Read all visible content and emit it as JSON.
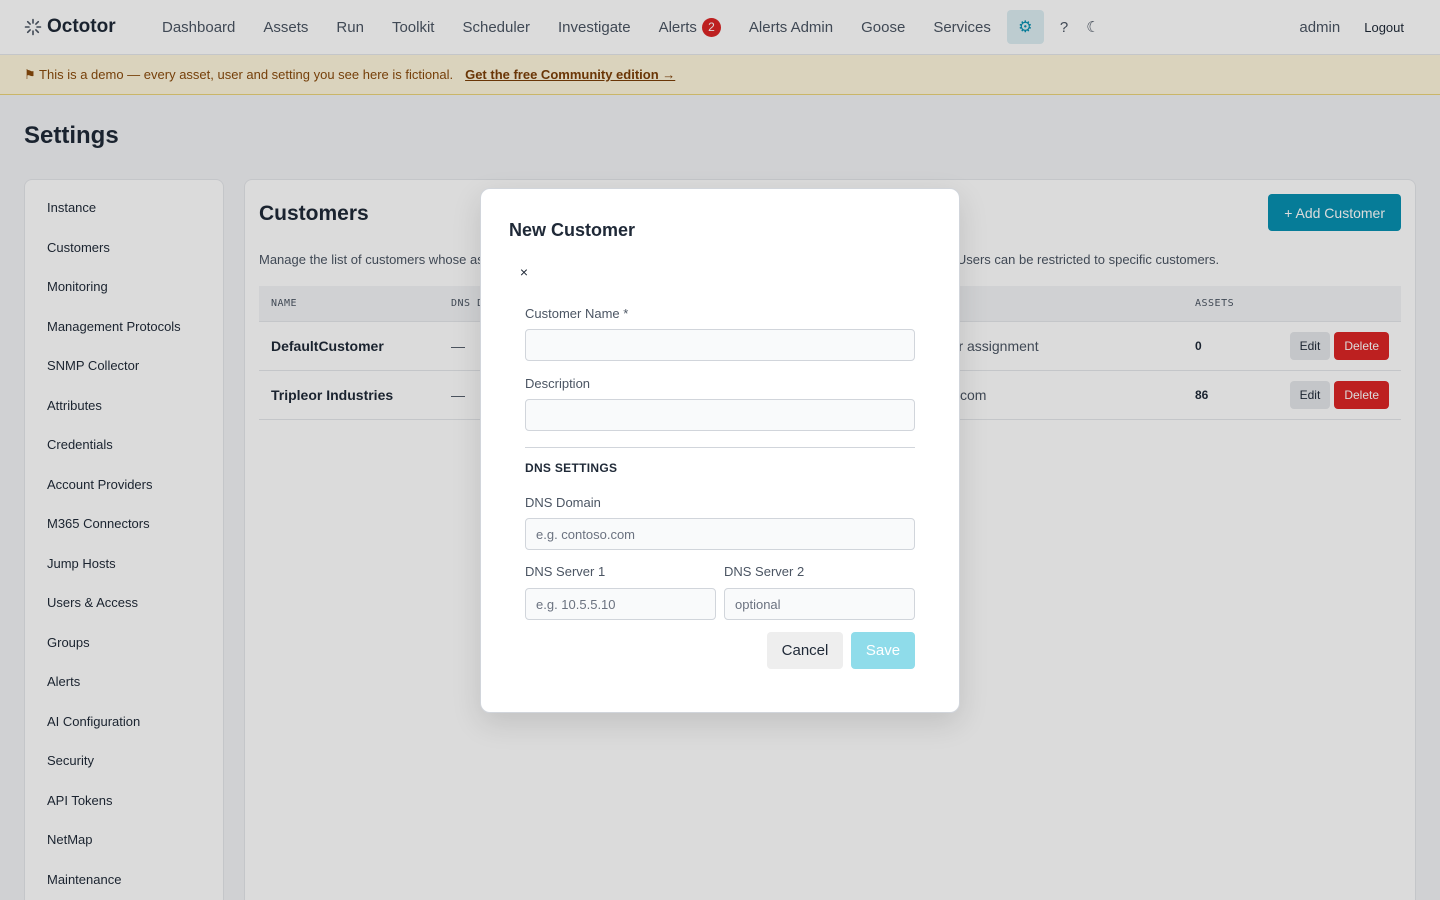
{
  "app": {
    "name": "Octotor",
    "icon": "octotor-spark-icon"
  },
  "nav": {
    "items": [
      {
        "label": "Dashboard"
      },
      {
        "label": "Assets"
      },
      {
        "label": "Run"
      },
      {
        "label": "Toolkit"
      },
      {
        "label": "Scheduler"
      },
      {
        "label": "Investigate"
      },
      {
        "label": "Alerts",
        "badge": "2"
      },
      {
        "label": "Alerts Admin"
      },
      {
        "label": "Goose"
      },
      {
        "label": "Services"
      }
    ],
    "settings_icon": "gear-icon",
    "help_label": "?",
    "theme_icon": "moon-icon",
    "user": "admin",
    "logout_label": "Logout"
  },
  "banner": {
    "text": "⚑ This is a demo — every asset, user and setting you see here is fictional.",
    "link": "Get the free Community edition →"
  },
  "page_title": "Settings",
  "sidebar": {
    "items": [
      {
        "label": "Instance"
      },
      {
        "label": "Customers"
      },
      {
        "label": "Monitoring"
      },
      {
        "label": "Management Protocols"
      },
      {
        "label": "SNMP Collector"
      },
      {
        "label": "Attributes"
      },
      {
        "label": "Credentials"
      },
      {
        "label": "Account Providers"
      },
      {
        "label": "M365 Connectors"
      },
      {
        "label": "Jump Hosts"
      },
      {
        "label": "Users & Access"
      },
      {
        "label": "Groups"
      },
      {
        "label": "Alerts"
      },
      {
        "label": "AI Configuration"
      },
      {
        "label": "Security"
      },
      {
        "label": "API Tokens"
      },
      {
        "label": "NetMap"
      },
      {
        "label": "Maintenance"
      }
    ]
  },
  "panel": {
    "title": "Customers",
    "add_label": "+ Add Customer",
    "description_start": "Manage the list of customers whose as",
    "description_end": "omer. Users can be restricted to specific customers.",
    "columns": {
      "name": "NAME",
      "dns": "DNS D",
      "assets": "ASSETS"
    },
    "rows": [
      {
        "name": "DefaultCustomer",
        "dns": "—",
        "mid": "mer assignment",
        "assets": "0",
        "edit": "Edit",
        "delete": "Delete"
      },
      {
        "name": "Tripleor Industries",
        "dns": "—",
        "mid": "com",
        "assets": "86",
        "edit": "Edit",
        "delete": "Delete"
      }
    ]
  },
  "modal": {
    "title": "New Customer",
    "close_label": "×",
    "fields": {
      "customer_name": {
        "label": "Customer Name *",
        "value": "",
        "placeholder": ""
      },
      "description": {
        "label": "Description",
        "value": "",
        "placeholder": ""
      },
      "dns_domain": {
        "label": "DNS Domain",
        "value": "",
        "placeholder": "e.g. contoso.com"
      },
      "dns_server_1": {
        "label": "DNS Server 1",
        "value": "",
        "placeholder": "e.g. 10.5.5.10"
      },
      "dns_server_2": {
        "label": "DNS Server 2",
        "value": "",
        "placeholder": "optional"
      }
    },
    "section_title": "DNS SETTINGS",
    "cancel_label": "Cancel",
    "save_label": "Save"
  },
  "colors": {
    "accent": "#0891b2",
    "danger": "#dc2626",
    "banner_bg": "#fef6dc",
    "save_disabled": "#8fdcea"
  }
}
